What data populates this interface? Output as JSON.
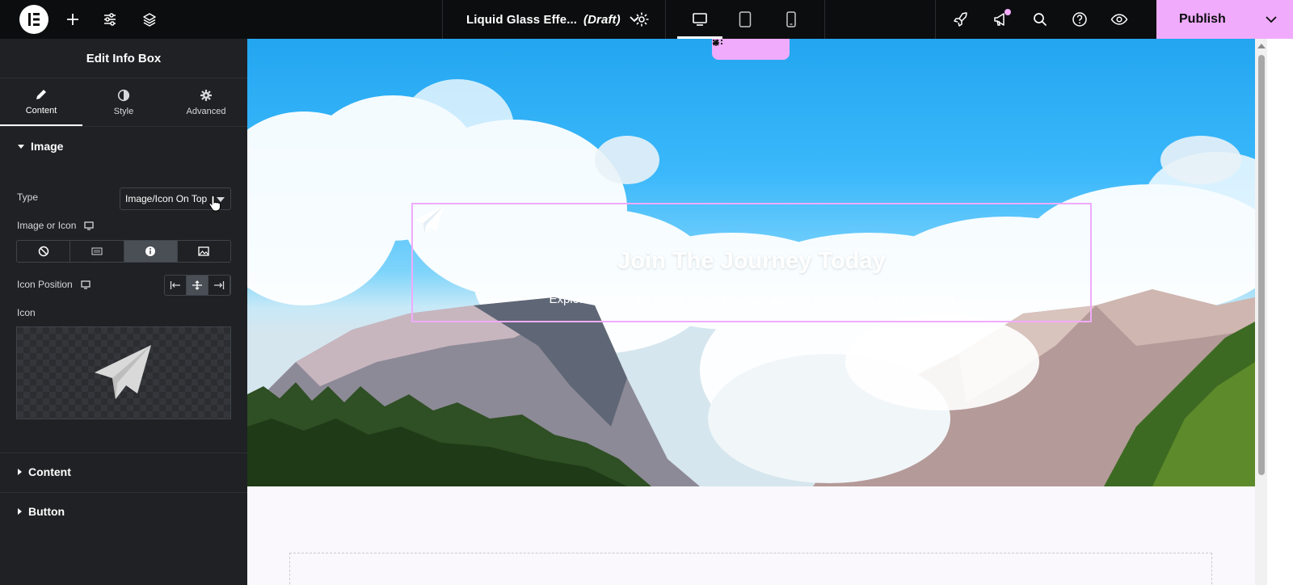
{
  "topbar": {
    "logo": "elementor-logo",
    "document_title": "Liquid Glass Effe...",
    "document_status": "(Draft)",
    "publish_label": "Publish",
    "icons": [
      "plus-icon",
      "sliders-icon",
      "layers-icon",
      "chevron-down-icon",
      "gear-icon",
      "desktop-icon",
      "tablet-icon",
      "mobile-icon",
      "rocket-icon",
      "megaphone-icon",
      "search-icon",
      "help-icon",
      "eye-icon"
    ]
  },
  "panel": {
    "title": "Edit Info Box",
    "tabs": [
      {
        "label": "Content",
        "icon": "pencil-icon",
        "active": true
      },
      {
        "label": "Style",
        "icon": "half-circle-icon",
        "active": false
      },
      {
        "label": "Advanced",
        "icon": "gear-icon",
        "active": false
      }
    ],
    "section_image": "Image",
    "type_label": "Type",
    "type_value": "Image/Icon On Top",
    "image_or_icon_label": "Image or Icon",
    "image_or_icon_selected": "icon",
    "icon_position_label": "Icon Position",
    "icon_position_selected": "center",
    "icon_label": "Icon",
    "section_content": "Content",
    "section_button": "Button"
  },
  "canvas": {
    "info_title": "Join The Journey Today",
    "info_description": "Explore around the world and make your journey memorable and wonderful",
    "accent_color": "#f0abfc"
  },
  "colors": {
    "topbar_bg": "#0c0d0e",
    "panel_bg": "#1f2124",
    "publish_bg": "#f0abfc"
  }
}
